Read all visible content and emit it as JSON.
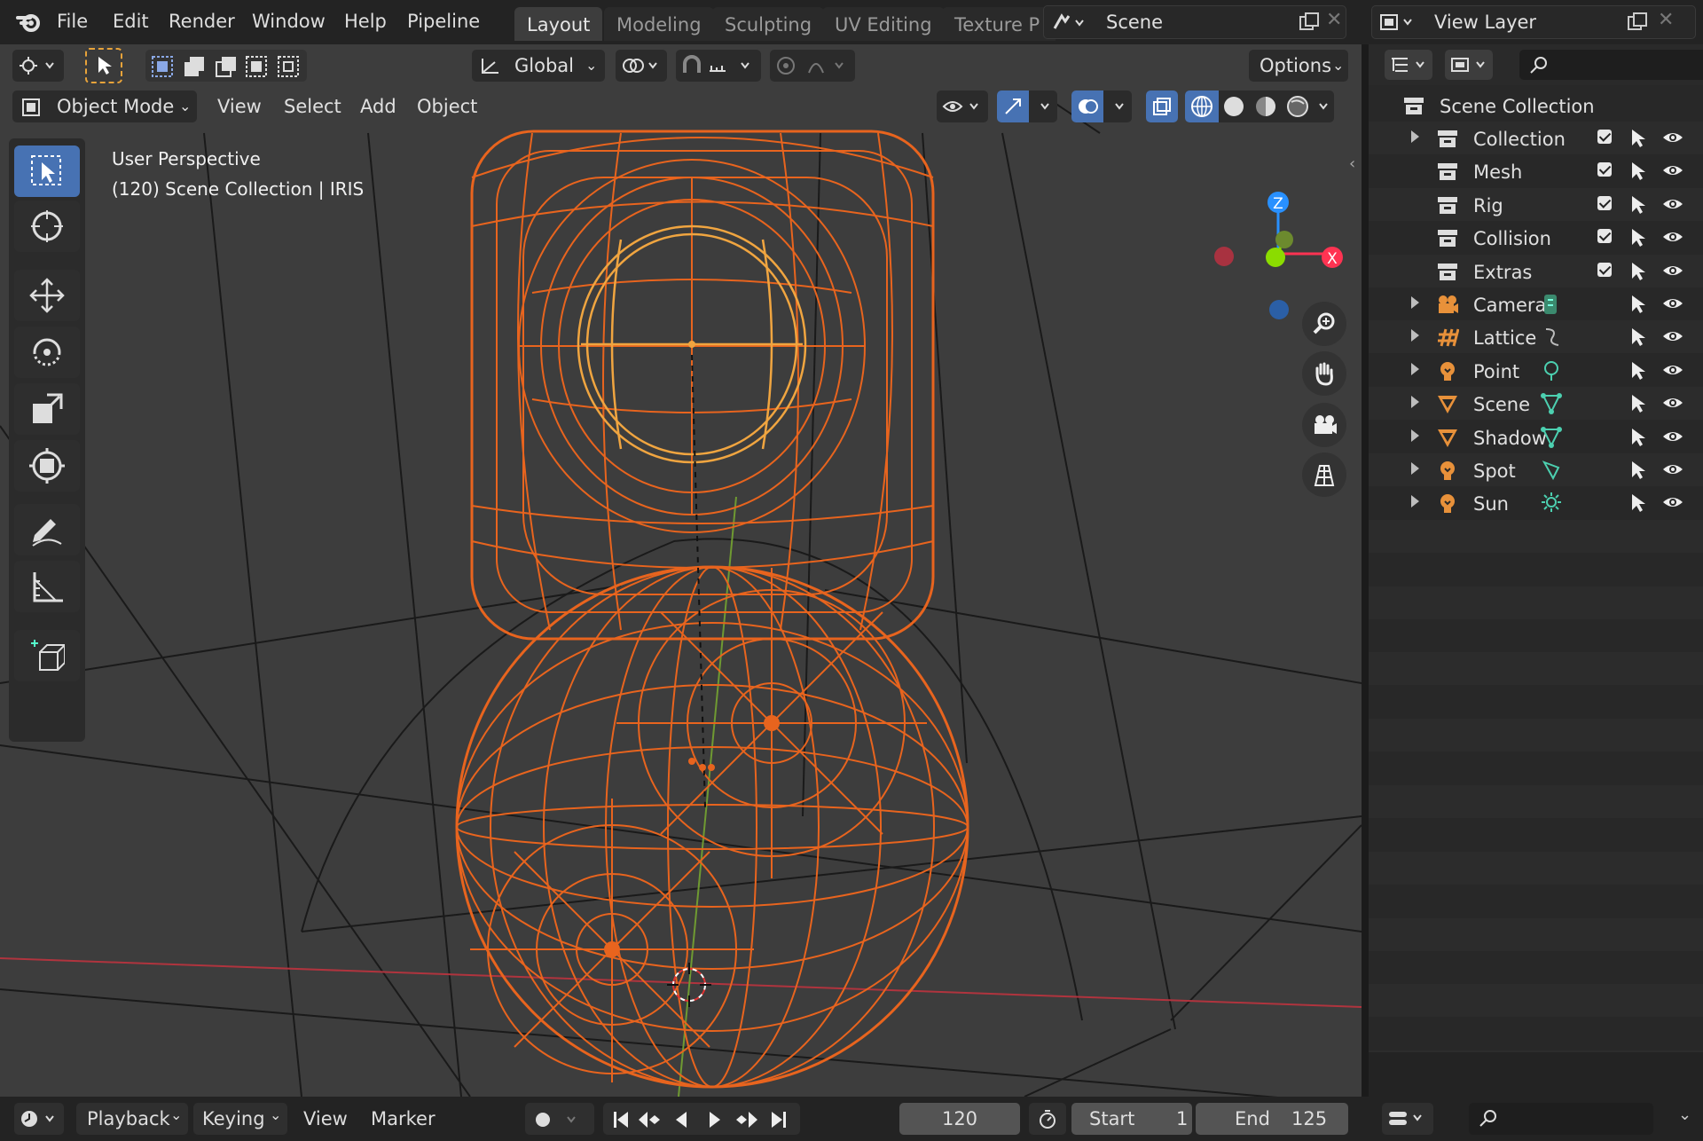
{
  "menu": [
    "File",
    "Edit",
    "Render",
    "Window",
    "Help",
    "Pipeline"
  ],
  "workspaces": [
    {
      "label": "Layout",
      "active": true
    },
    {
      "label": "Modeling",
      "active": false
    },
    {
      "label": "Sculpting",
      "active": false
    },
    {
      "label": "UV Editing",
      "active": false
    },
    {
      "label": "Texture P",
      "active": false
    }
  ],
  "scene_field": "Scene",
  "view_layer_field": "View Layer",
  "viewport": {
    "transform_orientation": "Global",
    "options_label": "Options",
    "mode_label": "Object Mode",
    "menus": [
      "View",
      "Select",
      "Add",
      "Object"
    ],
    "info_line1": "User Perspective",
    "info_line2": "(120) Scene Collection | IRIS",
    "gizmo": {
      "z": "Z",
      "x": "X"
    }
  },
  "outliner": {
    "root": "Scene Collection",
    "rows": [
      {
        "label": "Collection",
        "expandable": true,
        "checkbox": true,
        "icon": "collection-icon",
        "extra": ""
      },
      {
        "label": "Mesh",
        "expandable": false,
        "checkbox": true,
        "icon": "collection-icon",
        "extra": ""
      },
      {
        "label": "Rig",
        "expandable": false,
        "checkbox": true,
        "icon": "collection-icon",
        "extra": ""
      },
      {
        "label": "Collision",
        "expandable": false,
        "checkbox": true,
        "icon": "collection-icon",
        "extra": ""
      },
      {
        "label": "Extras",
        "expandable": false,
        "checkbox": true,
        "icon": "collection-icon",
        "extra": ""
      },
      {
        "label": "Camera",
        "expandable": true,
        "checkbox": false,
        "icon": "camera-object-icon",
        "extra": "camera-data-icon"
      },
      {
        "label": "Lattice",
        "expandable": true,
        "checkbox": false,
        "icon": "lattice-object-icon",
        "extra": "lattice-data-icon"
      },
      {
        "label": "Point",
        "expandable": true,
        "checkbox": false,
        "icon": "light-object-icon",
        "extra": "point-light-icon"
      },
      {
        "label": "Scene",
        "expandable": true,
        "checkbox": false,
        "icon": "mesh-object-icon",
        "extra": "mesh-data-icon"
      },
      {
        "label": "Shadow",
        "expandable": true,
        "checkbox": false,
        "icon": "mesh-object-icon",
        "extra": "mesh-data-icon"
      },
      {
        "label": "Spot",
        "expandable": true,
        "checkbox": false,
        "icon": "light-object-icon",
        "extra": "spot-light-icon"
      },
      {
        "label": "Sun",
        "expandable": true,
        "checkbox": false,
        "icon": "light-object-icon",
        "extra": "sun-light-icon"
      }
    ]
  },
  "timeline": {
    "menus": [
      "Playback",
      "Keying",
      "View",
      "Marker"
    ],
    "current_frame": "120",
    "start_label": "Start",
    "start_value": "1",
    "end_label": "End",
    "end_value": "125"
  },
  "colors": {
    "accent": "#4772b3",
    "selection_orange": "#e8641e",
    "axis_x": "#ff3352",
    "axis_y": "#8bdc00",
    "axis_z": "#2890ff"
  }
}
